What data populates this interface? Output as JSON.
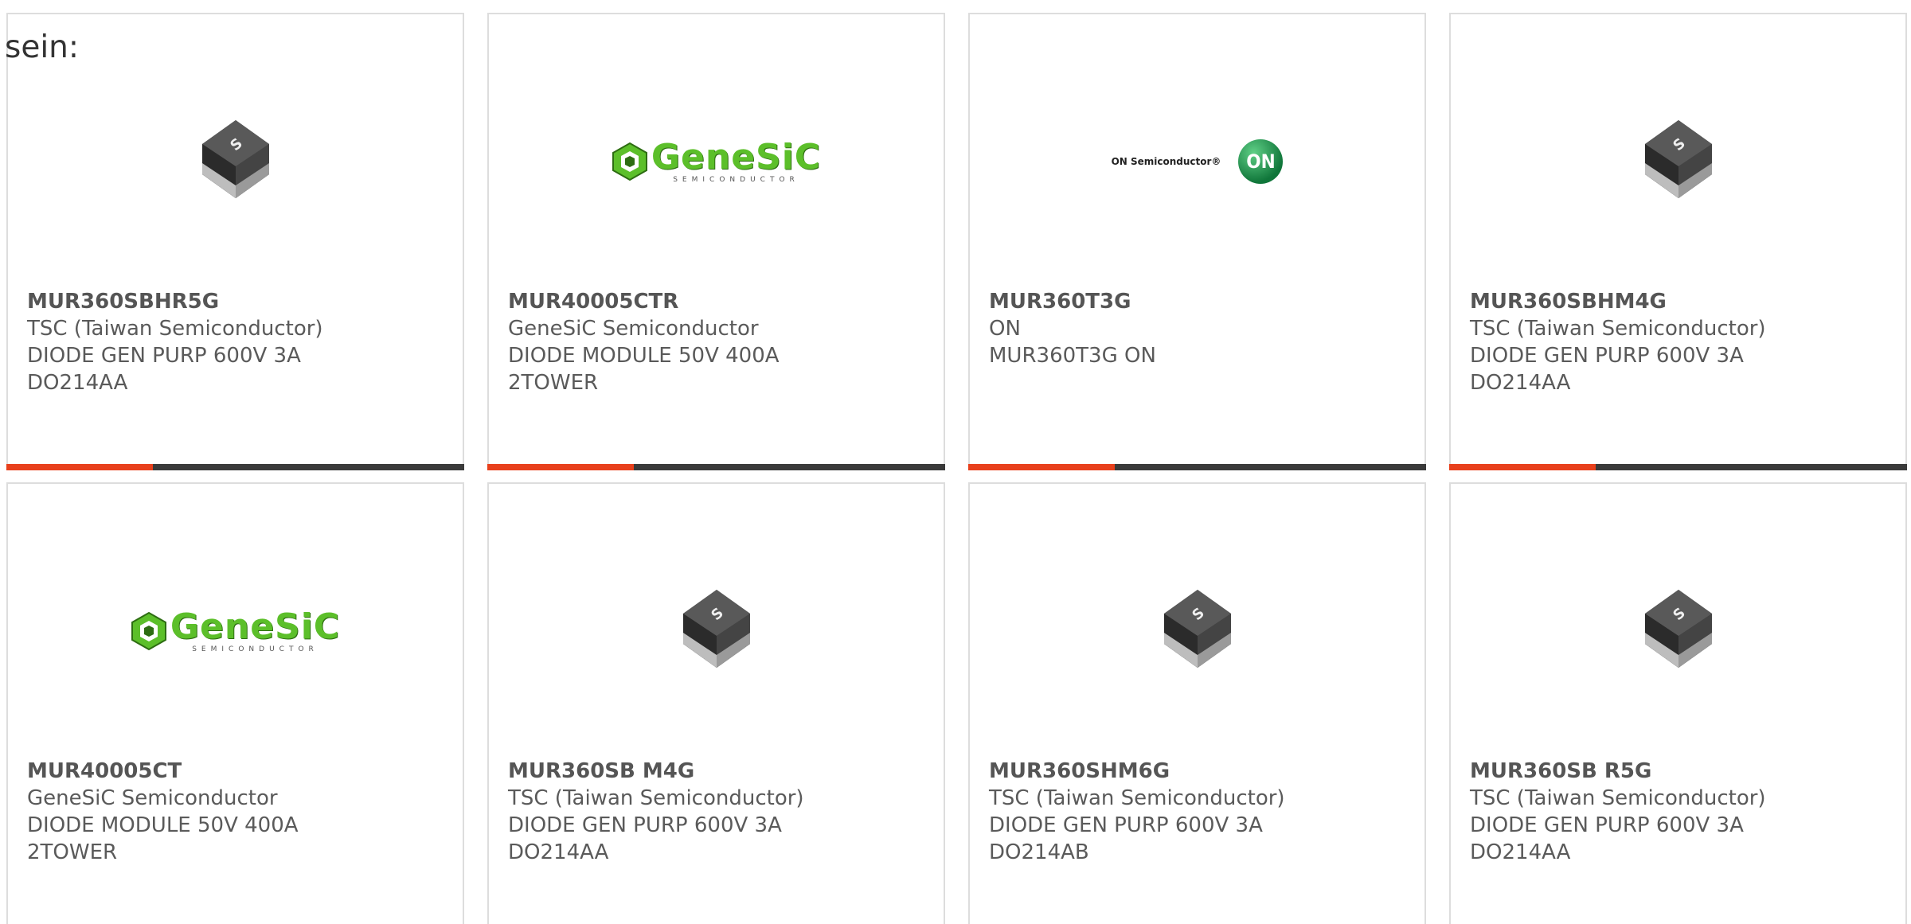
{
  "intro_text": "sein:",
  "accent_color": "#e8401c",
  "bar_color": "#3a3a3a",
  "cards": [
    {
      "part": "MUR360SBHR5G",
      "maker": "TSC (Taiwan Semiconductor)",
      "desc1": "DIODE GEN PURP 600V 3A",
      "desc2": "DO214AA",
      "image": "diode-package-icon"
    },
    {
      "part": "MUR40005CTR",
      "maker": "GeneSiC Semiconductor",
      "desc1": "DIODE MODULE 50V 400A",
      "desc2": "2TOWER",
      "image": "genesic-logo",
      "logo_name": "GeneSiC",
      "logo_sub": "SEMICONDUCTOR"
    },
    {
      "part": "MUR360T3G",
      "maker": "ON",
      "desc1": "MUR360T3G ON",
      "desc2": "",
      "image": "on-semiconductor-logo",
      "logo_wordmark": "ON Semiconductor®",
      "logo_badge": "ON"
    },
    {
      "part": "MUR360SBHM4G",
      "maker": "TSC (Taiwan Semiconductor)",
      "desc1": "DIODE GEN PURP 600V 3A",
      "desc2": "DO214AA",
      "image": "diode-package-icon"
    },
    {
      "part": "MUR40005CT",
      "maker": "GeneSiC Semiconductor",
      "desc1": "DIODE MODULE 50V 400A",
      "desc2": "2TOWER",
      "image": "genesic-logo",
      "logo_name": "GeneSiC",
      "logo_sub": "SEMICONDUCTOR"
    },
    {
      "part": "MUR360SB M4G",
      "maker": "TSC (Taiwan Semiconductor)",
      "desc1": "DIODE GEN PURP 600V 3A",
      "desc2": "DO214AA",
      "image": "diode-package-icon"
    },
    {
      "part": "MUR360SHM6G",
      "maker": "TSC (Taiwan Semiconductor)",
      "desc1": "DIODE GEN PURP 600V 3A",
      "desc2": "DO214AB",
      "image": "diode-package-icon"
    },
    {
      "part": "MUR360SB R5G",
      "maker": "TSC (Taiwan Semiconductor)",
      "desc1": "DIODE GEN PURP 600V 3A",
      "desc2": "DO214AA",
      "image": "diode-package-icon"
    }
  ]
}
